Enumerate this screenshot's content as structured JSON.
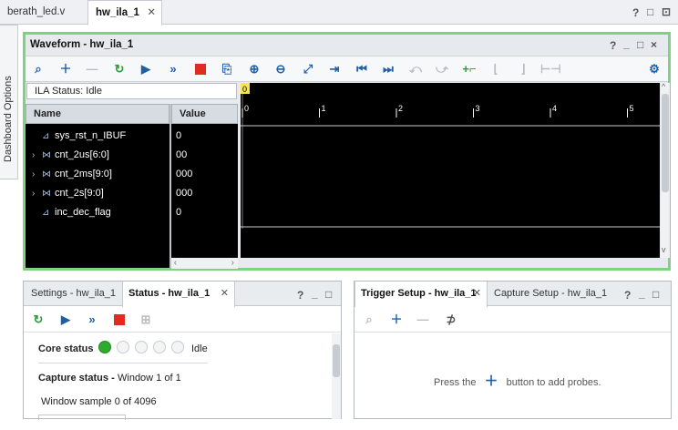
{
  "file_tabs": [
    {
      "label": "berath_led.v",
      "active": false
    },
    {
      "label": "hw_ila_1",
      "active": true
    }
  ],
  "window_controls": [
    "?",
    "□",
    "⊡"
  ],
  "side_tab": "Dashboard Options",
  "waveform": {
    "title": "Waveform - hw_ila_1",
    "header_controls": [
      "?",
      "_",
      "□",
      "×"
    ],
    "ila_status": "ILA Status: Idle",
    "columns": {
      "name": "Name",
      "value": "Value"
    },
    "marker": "0",
    "ticks": [
      "0",
      "1",
      "2",
      "3",
      "4",
      "5"
    ],
    "signals": [
      {
        "name": "sys_rst_n_IBUF",
        "value": "0",
        "bus": false
      },
      {
        "name": "cnt_2us[6:0]",
        "value": "00",
        "bus": true
      },
      {
        "name": "cnt_2ms[9:0]",
        "value": "000",
        "bus": true
      },
      {
        "name": "cnt_2s[9:0]",
        "value": "000",
        "bus": true
      },
      {
        "name": "inc_dec_flag",
        "value": "0",
        "bus": false
      }
    ]
  },
  "status_panel": {
    "tabs": [
      {
        "label": "Settings - hw_ila_1",
        "active": false
      },
      {
        "label": "Status - hw_ila_1",
        "active": true
      }
    ],
    "controls": [
      "?",
      "_",
      "□"
    ],
    "core_status_label": "Core status",
    "core_status_value": "Idle",
    "capture_status_label": "Capture status -",
    "capture_status_value": "Window 1 of 1",
    "window_sample": "Window sample 0 of 4096"
  },
  "trigger_panel": {
    "tabs": [
      {
        "label": "Trigger Setup - hw_ila_1",
        "active": true
      },
      {
        "label": "Capture Setup - hw_ila_1",
        "active": false
      }
    ],
    "controls": [
      "?",
      "_",
      "□"
    ],
    "hint_before": "Press the",
    "hint_after": "button to add probes."
  },
  "colors": {
    "accent_green": "#7fd27f",
    "brand_blue": "#1f5fa8",
    "stop_red": "#e02b20",
    "led_green": "#2eab2e"
  }
}
